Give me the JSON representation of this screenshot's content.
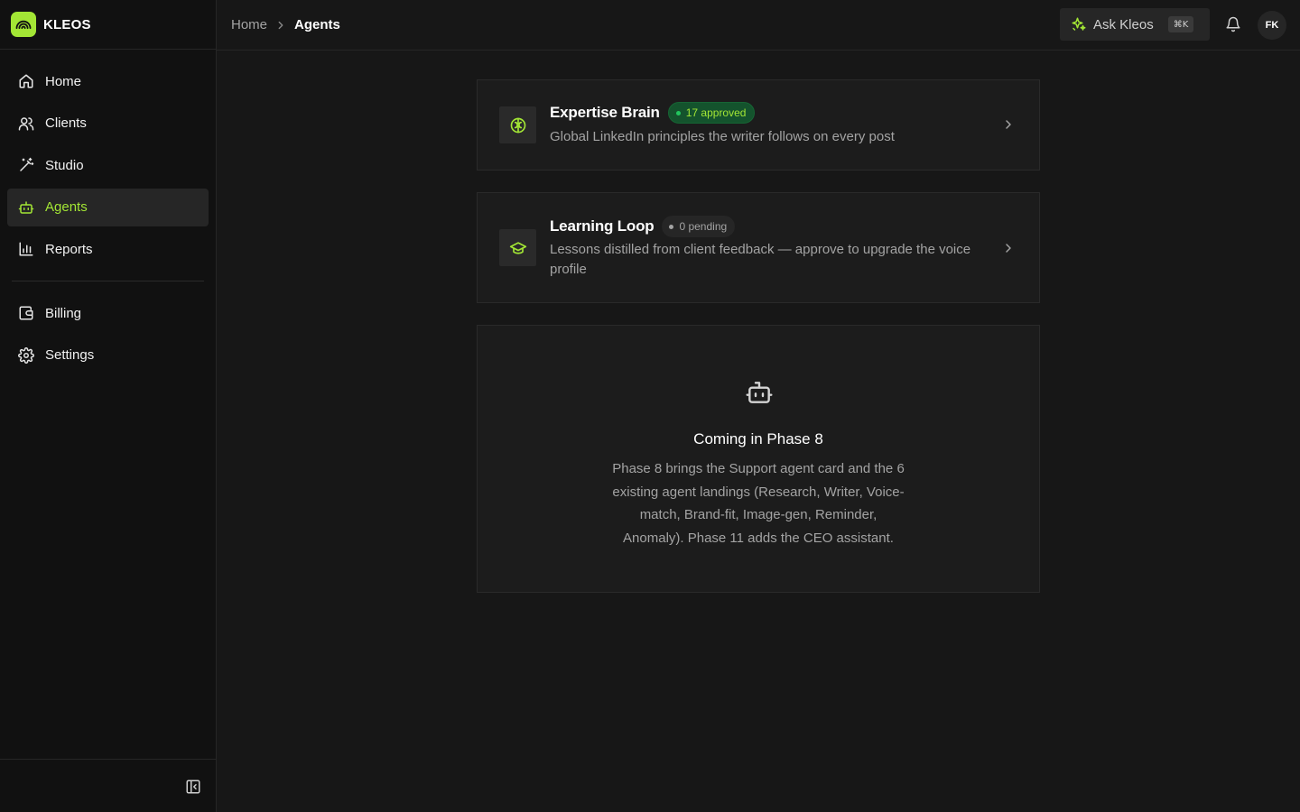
{
  "brand": {
    "name": "KLEOS",
    "logo_icon": "rainbow-icon",
    "accent": "#a3e635"
  },
  "sidebar": {
    "items": [
      {
        "label": "Home",
        "icon": "home-icon"
      },
      {
        "label": "Clients",
        "icon": "users-icon"
      },
      {
        "label": "Studio",
        "icon": "magic-wand-icon"
      },
      {
        "label": "Agents",
        "icon": "bot-icon",
        "active": true
      },
      {
        "label": "Reports",
        "icon": "bar-chart-icon"
      }
    ],
    "secondary": [
      {
        "label": "Billing",
        "icon": "wallet-icon"
      },
      {
        "label": "Settings",
        "icon": "gear-icon"
      }
    ],
    "collapse_icon": "panel-collapse-icon"
  },
  "topbar": {
    "breadcrumb": {
      "home": "Home",
      "current": "Agents"
    },
    "ask": {
      "label": "Ask Kleos",
      "shortcut": "⌘K",
      "icon": "sparkles-icon"
    },
    "bell_icon": "bell-icon",
    "avatar_initials": "FK"
  },
  "cards": [
    {
      "title": "Expertise Brain",
      "badge": "17 approved",
      "badge_color": "#22c55e",
      "description": "Global LinkedIn principles the writer follows on every post",
      "icon": "brain-icon"
    },
    {
      "title": "Learning Loop",
      "badge": "0 pending",
      "badge_color": "#a3a3a3",
      "description": "Lessons distilled from client feedback — approve to upgrade the voice profile",
      "icon": "graduation-cap-icon"
    }
  ],
  "phase": {
    "icon": "bot-icon",
    "title": "Coming in Phase 8",
    "description": "Phase 8 brings the Support agent card and the 6 existing agent landings (Research, Writer, Voice-match, Brand-fit, Image-gen, Reminder, Anomaly). Phase 11 adds the CEO assistant."
  }
}
